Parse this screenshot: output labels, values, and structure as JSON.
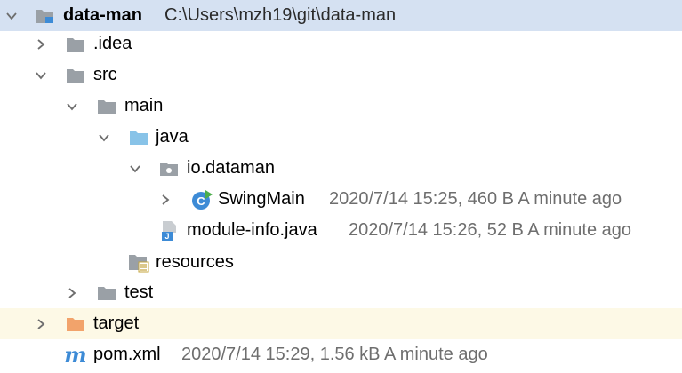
{
  "root": {
    "name": "data-man",
    "path": "C:\\Users\\mzh19\\git\\data-man"
  },
  "items": {
    "idea": {
      "label": ".idea"
    },
    "src": {
      "label": "src"
    },
    "main": {
      "label": "main"
    },
    "java": {
      "label": "java"
    },
    "package": {
      "label": "io.dataman"
    },
    "swingmain": {
      "label": "SwingMain",
      "meta": "2020/7/14 15:25, 460 B A minute ago"
    },
    "moduleinfo": {
      "label": "module-info.java",
      "meta": "2020/7/14 15:26, 52 B A minute ago"
    },
    "resources": {
      "label": "resources"
    },
    "test": {
      "label": "test"
    },
    "target": {
      "label": "target"
    },
    "pom": {
      "label": "pom.xml",
      "meta": "2020/7/14 15:29, 1.56 kB A minute ago"
    }
  },
  "icons": {
    "maven_letter": "m",
    "class_letter": "C",
    "module_letter": "J"
  },
  "colors": {
    "selection": "#d5e1f2",
    "excluded_row": "#fdf9e6",
    "folder_gray": "#9aa0a6",
    "source_folder": "#88c3e8",
    "excluded_folder": "#f2a36b",
    "maven_blue": "#3d8bd6"
  }
}
